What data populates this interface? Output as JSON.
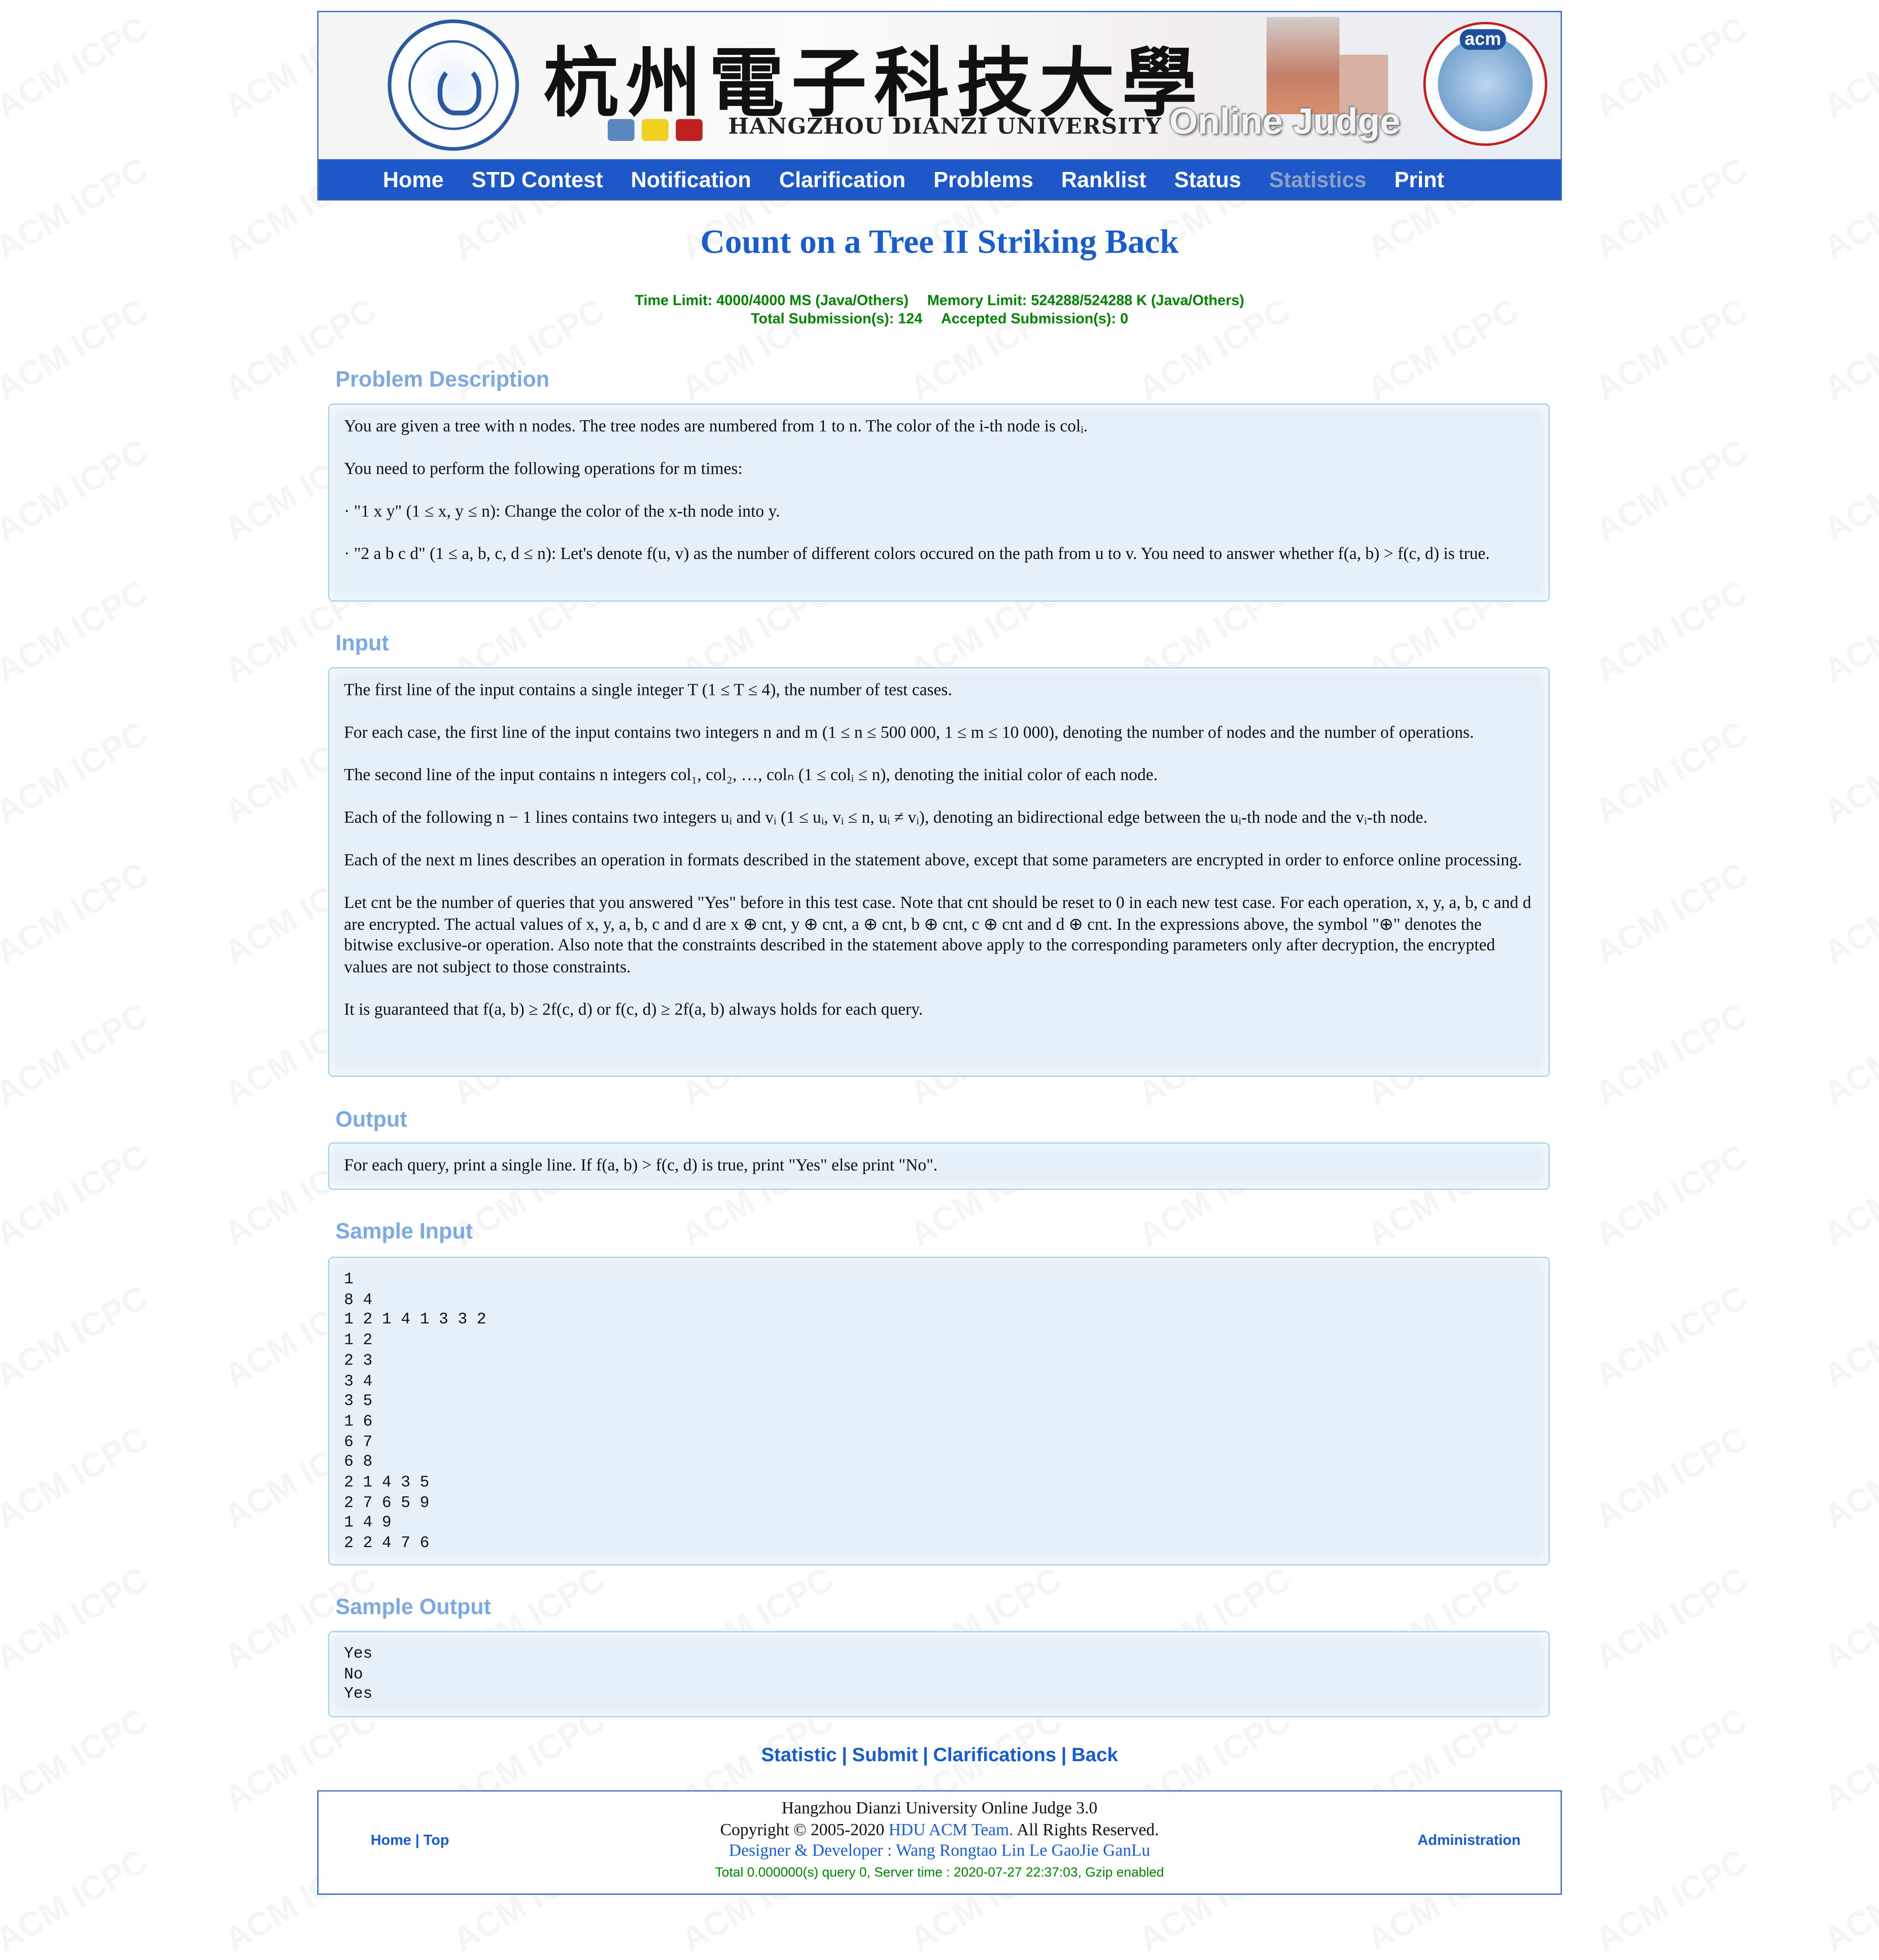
{
  "header": {
    "cn_title": "杭州電子科技大學",
    "en_title": "HANGZHOU DIANZI UNIVERSITY",
    "oj_title": "Online Judge",
    "acm_logo_text": "acm",
    "left_logo": "hdu-seal-logo",
    "right_logo": "acm-icpc-logo"
  },
  "nav": {
    "home": "Home",
    "std_contest": "STD Contest",
    "notification": "Notification",
    "clarification": "Clarification",
    "problems": "Problems",
    "ranklist": "Ranklist",
    "status": "Status",
    "statistics": "Statistics",
    "print": "Print"
  },
  "watermark": "ACM ICPC",
  "problem": {
    "title": "Count on a Tree II Striking Back",
    "time_limit": "Time Limit: 4000/4000 MS (Java/Others)",
    "memory_limit": "Memory Limit: 524288/524288 K (Java/Others)",
    "total_submissions": "Total Submission(s): 124",
    "accepted_submissions": "Accepted Submission(s): 0"
  },
  "sections": {
    "description_heading": "Problem Description",
    "input_heading": "Input",
    "output_heading": "Output",
    "sample_input_heading": "Sample Input",
    "sample_output_heading": "Sample Output"
  },
  "description": {
    "p1": "You are given a tree with n nodes. The tree nodes are numbered from 1 to n. The color of the i-th node is colᵢ.",
    "p2": "You need to perform the following operations for m times:",
    "op1": "· \"1 x y\" (1 ≤ x, y ≤ n): Change the color of the x-th node into y.",
    "op2": "· \"2 a b c d\" (1 ≤ a, b, c, d ≤ n): Let's denote f(u, v) as the number of different colors occured on the path from u to v. You need to answer whether f(a, b) > f(c, d) is true."
  },
  "input": {
    "p1": "The first line of the input contains a single integer T (1 ≤ T ≤ 4), the number of test cases.",
    "p2": "For each case, the first line of the input contains two integers n and m (1 ≤ n ≤ 500 000, 1 ≤ m ≤ 10 000), denoting the number of nodes and the number of operations.",
    "p3": "The second line of the input contains n integers col₁, col₂, …, colₙ (1 ≤ colᵢ ≤ n), denoting the initial color of each node.",
    "p4": "Each of the following n − 1 lines contains two integers uᵢ and vᵢ (1 ≤ uᵢ, vᵢ ≤ n, uᵢ ≠ vᵢ), denoting an bidirectional edge between the uᵢ-th node and the vᵢ-th node.",
    "p5": "Each of the next m lines describes an operation in formats described in the statement above, except that some parameters are encrypted in order to enforce online processing.",
    "p6": "Let cnt be the number of queries that you answered \"Yes\" before in this test case. Note that cnt should be reset to 0 in each new test case. For each operation, x, y, a, b, c and d are encrypted. The actual values of x, y, a, b, c and d are x ⊕ cnt, y ⊕ cnt, a ⊕ cnt, b ⊕ cnt, c ⊕ cnt and d ⊕ cnt. In the expressions above, the symbol \"⊕\" denotes the bitwise exclusive-or operation. Also note that the constraints described in the statement above apply to the corresponding parameters only after decryption, the encrypted values are not subject to those constraints.",
    "p7": "It is guaranteed that f(a, b) ≥ 2f(c, d) or f(c, d) ≥ 2f(a, b) always holds for each query."
  },
  "output": {
    "p1": "For each query, print a single line. If f(a, b) > f(c, d) is true, print \"Yes\" else print \"No\"."
  },
  "sample_input": "1\n8 4\n1 2 1 4 1 3 3 2\n1 2\n2 3\n3 4\n3 5\n1 6\n6 7\n6 8\n2 1 4 3 5\n2 7 6 5 9\n1 4 9\n2 2 4 7 6",
  "sample_output": "Yes\nNo\nYes",
  "bottom_links": {
    "statistic": "Statistic",
    "submit": "Submit",
    "clarifications": "Clarifications",
    "back": "Back",
    "sep": "|"
  },
  "footer": {
    "home": "Home",
    "top": "Top",
    "sep": "|",
    "administration": "Administration",
    "line1": "Hangzhou Dianzi University Online Judge 3.0",
    "copyright_pre": "Copyright © 2005-2020",
    "team": "HDU ACM Team.",
    "rights": "All Rights Reserved.",
    "designer_label": "Designer & Developer :",
    "designers": "Wang Rongtao Lin Le GaoJie GanLu",
    "server_info": "Total 0.000000(s) query 0, Server time : 2020-07-27 22:37:03, Gzip enabled"
  }
}
